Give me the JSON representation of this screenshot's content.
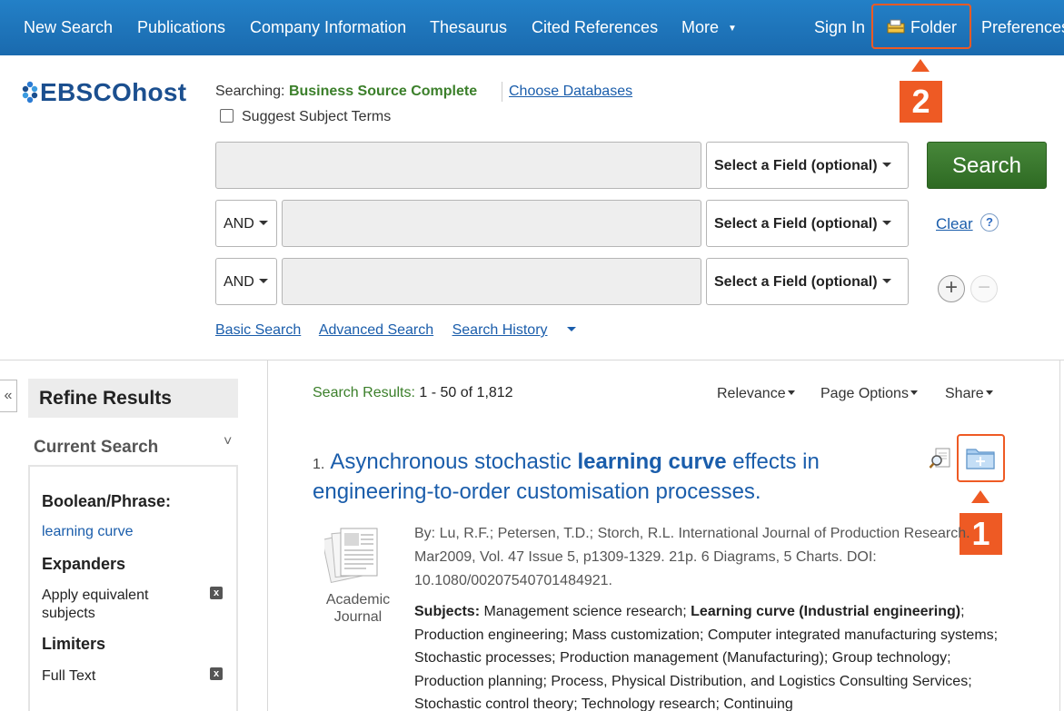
{
  "topnav": {
    "items": [
      "New Search",
      "Publications",
      "Company Information",
      "Thesaurus",
      "Cited References",
      "More",
      "Sign In",
      "Folder",
      "Preferences"
    ]
  },
  "logo": {
    "text": "EBSCOhost"
  },
  "searching": {
    "label": "Searching:",
    "database": "Business Source Complete",
    "choose_link": "Choose Databases"
  },
  "suggest_terms": "Suggest Subject Terms",
  "search_rows": {
    "field_select": "Select a Field (optional)",
    "boolean_op": "AND"
  },
  "search_button": "Search",
  "clear_link": "Clear",
  "help_glyph": "?",
  "row_add": "+",
  "row_remove": "−",
  "links": [
    "Basic Search",
    "Advanced Search",
    "Search History"
  ],
  "sidebar": {
    "collapse_glyph": "«",
    "refine_title": "Refine Results",
    "current_search_title": "Current Search",
    "boolean_heading": "Boolean/Phrase:",
    "boolean_value": "learning curve",
    "expanders_heading": "Expanders",
    "expanders_value": "Apply equivalent subjects",
    "limiters_heading": "Limiters",
    "limiters_value": "Full Text",
    "remove_glyph": "x"
  },
  "results": {
    "label": "Search Results:",
    "range": "1 - 50 of 1,812",
    "sort": "Relevance",
    "page_options": "Page Options",
    "share": "Share"
  },
  "result1": {
    "number": "1.",
    "title_pre": "Asynchronous stochastic ",
    "title_bold": "learning curve",
    "title_post": " effects in engineering-to-order customisation processes.",
    "meta": "By: Lu, R.F.; Petersen, T.D.; Storch, R.L. International Journal of Production Research. Mar2009, Vol. 47 Issue 5, p1309-1329. 21p. 6 Diagrams, 5 Charts. DOI: 10.1080/00207540701484921.",
    "pub_type": "Academic Journal",
    "subjects_label": "Subjects:",
    "subjects_pre": " Management science research; ",
    "subjects_bold": "Learning curve (Industrial engineering)",
    "subjects_post": "; Production engineering; Mass customization; Computer integrated manufacturing systems; Stochastic processes; Production management (Manufacturing); Group technology; Production planning; Process, Physical Distribution, and Logistics Consulting Services; Stochastic control theory; Technology research; Continuing"
  },
  "markers": {
    "one": "1",
    "two": "2"
  },
  "colors": {
    "nav": "#1d72b8",
    "accent": "#ee5a24",
    "search_green": "#3b7f2a",
    "link": "#1a5dab"
  }
}
